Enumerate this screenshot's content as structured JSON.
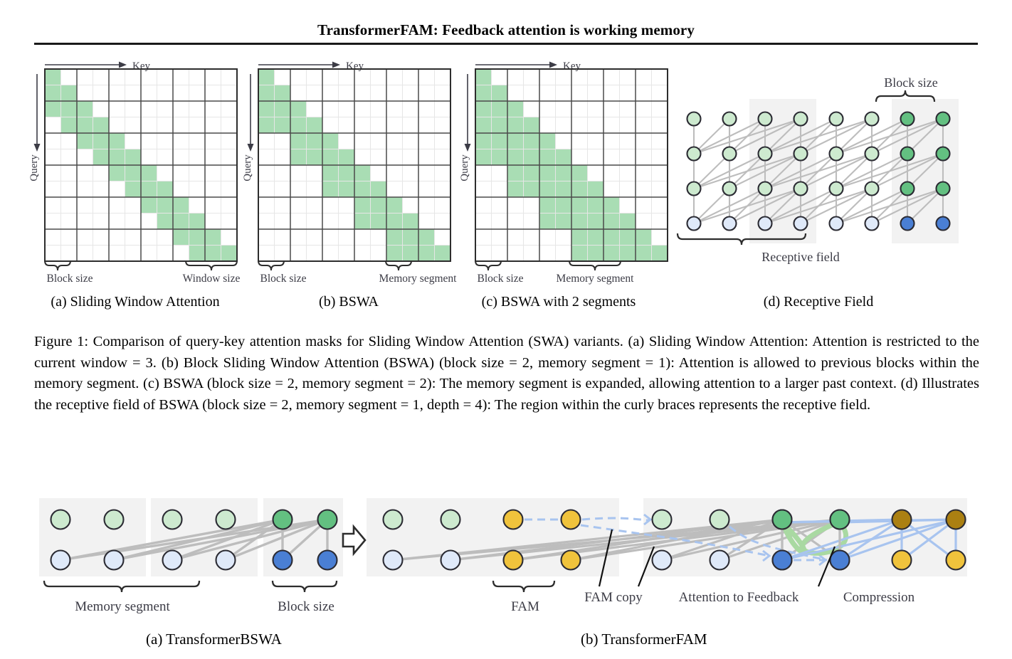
{
  "header": {
    "title": "TransformerFAM: Feedback attention is working memory"
  },
  "figure1": {
    "panels": [
      {
        "id": "swa",
        "caption": "(a) Sliding Window Attention",
        "axis_x_label": "Key",
        "axis_y_label": "Query",
        "brace_left_label": "Block size",
        "brace_right_label": "Window size"
      },
      {
        "id": "bswa",
        "caption": "(b) BSWA",
        "axis_x_label": "Key",
        "axis_y_label": "Query",
        "brace_left_label": "Block size",
        "brace_right_label": "Memory segment"
      },
      {
        "id": "bswa2",
        "caption": "(c) BSWA with 2 segments",
        "axis_x_label": "Key",
        "axis_y_label": "Query",
        "brace_left_label": "Block size",
        "brace_right_label": "Memory segment"
      },
      {
        "id": "receptive",
        "caption": "(d) Receptive Field",
        "brace_top_label": "Block size",
        "brace_bottom_label": "Receptive field"
      }
    ],
    "caption": "Figure 1: Comparison of query-key attention masks for Sliding Window Attention (SWA) variants. (a) Sliding Window Attention: Attention is restricted to the current window = 3. (b) Block Sliding Window Attention (BSWA) (block size = 2, memory segment = 1): Attention is allowed to previous blocks within the memory segment. (c) BSWA (block size = 2, memory segment = 2): The memory segment is expanded, allowing attention to a larger past context. (d) Illustrates the receptive field of BSWA (block size = 2, memory segment = 1, depth = 4): The region within the curly braces represents the receptive field."
  },
  "figure2": {
    "panels": [
      {
        "id": "bswa_arch",
        "caption": "(a) TransformerBSWA"
      },
      {
        "id": "fam_arch",
        "caption": "(b) TransformerFAM"
      }
    ],
    "labels": {
      "memory_segment": "Memory segment",
      "block_size": "Block size",
      "fam": "FAM",
      "fam_copy": "FAM copy",
      "attention_to_feedback": "Attention to Feedback",
      "compression": "Compression"
    }
  },
  "chart_data": {
    "type": "heatmap",
    "title": "Query-key attention masks",
    "grid": {
      "rows": 12,
      "cols": 12,
      "block_size": 2
    },
    "masks": {
      "swa": {
        "window": 3,
        "rows": [
          [
            0
          ],
          [
            0,
            1
          ],
          [
            0,
            1,
            2
          ],
          [
            1,
            2,
            3
          ],
          [
            2,
            3,
            4
          ],
          [
            3,
            4,
            5
          ],
          [
            4,
            5,
            6
          ],
          [
            5,
            6,
            7
          ],
          [
            6,
            7,
            8
          ],
          [
            7,
            8,
            9
          ],
          [
            8,
            9,
            10
          ],
          [
            9,
            10,
            11
          ]
        ]
      },
      "bswa": {
        "block_size": 2,
        "memory_segment": 1,
        "rows": [
          [
            0
          ],
          [
            0,
            1
          ],
          [
            0,
            1,
            2
          ],
          [
            0,
            1,
            2,
            3
          ],
          [
            2,
            3,
            4
          ],
          [
            2,
            3,
            4,
            5
          ],
          [
            4,
            5,
            6
          ],
          [
            4,
            5,
            6,
            7
          ],
          [
            6,
            7,
            8
          ],
          [
            6,
            7,
            8,
            9
          ],
          [
            8,
            9,
            10
          ],
          [
            8,
            9,
            10,
            11
          ]
        ]
      },
      "bswa2": {
        "block_size": 2,
        "memory_segment": 2,
        "rows": [
          [
            0
          ],
          [
            0,
            1
          ],
          [
            0,
            1,
            2
          ],
          [
            0,
            1,
            2,
            3
          ],
          [
            0,
            1,
            2,
            3,
            4
          ],
          [
            0,
            1,
            2,
            3,
            4,
            5
          ],
          [
            2,
            3,
            4,
            5,
            6
          ],
          [
            2,
            3,
            4,
            5,
            6,
            7
          ],
          [
            4,
            5,
            6,
            7,
            8
          ],
          [
            4,
            5,
            6,
            7,
            8,
            9
          ],
          [
            6,
            7,
            8,
            9,
            10
          ],
          [
            6,
            7,
            8,
            9,
            10,
            11
          ]
        ]
      }
    },
    "receptive_field": {
      "depth": 4,
      "tokens": 8,
      "block_size": 2,
      "memory_segment": 1,
      "highlighted_blocks": [
        2,
        6
      ]
    }
  },
  "colors": {
    "mask_fill": "#a9ddb4",
    "grid_line_minor": "#e6e6e6",
    "grid_line_major": "#4a4a4a",
    "node_green_dark": "#63c081",
    "node_green_light": "#cdeacf",
    "node_blue": "#4a7fd4",
    "node_blue_light": "#dfe9f9",
    "node_yellow": "#f0c33c",
    "node_yellow_dark": "#ab8012",
    "band_bg": "#f2f2f2",
    "edge_gray": "#bdbdbd",
    "edge_blue": "#a8c4ef",
    "edge_green": "#a9d9a2",
    "text": "#3c3c46"
  }
}
